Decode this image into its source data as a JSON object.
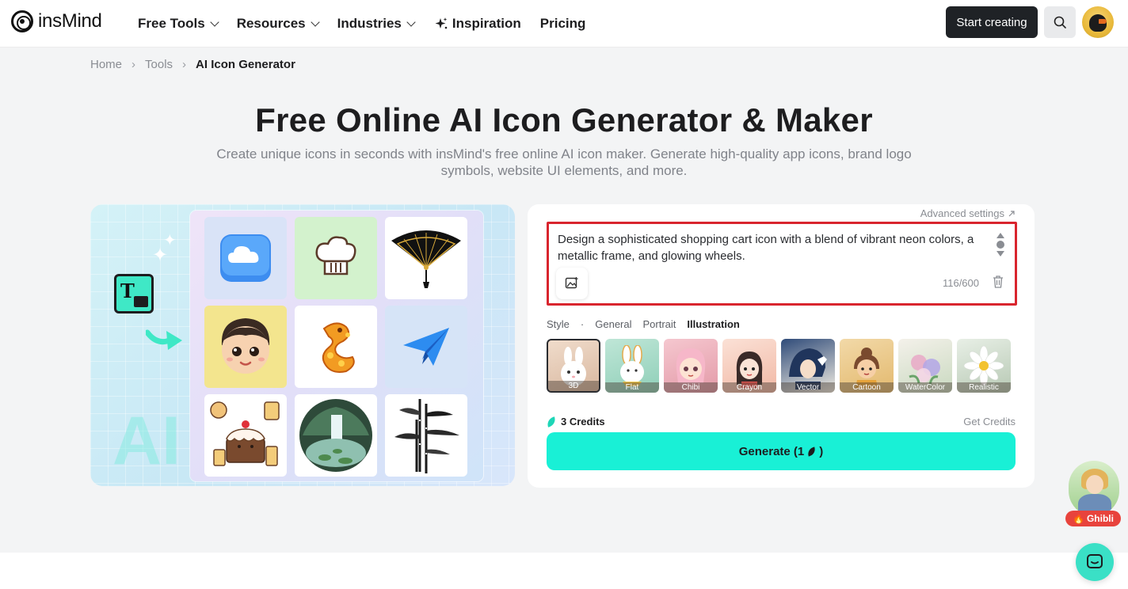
{
  "header": {
    "logo_text": "insMind",
    "nav": [
      {
        "label": "Free Tools",
        "dropdown": true
      },
      {
        "label": "Resources",
        "dropdown": true
      },
      {
        "label": "Industries",
        "dropdown": true
      },
      {
        "label": "Inspiration",
        "icon": "sparkle-icon"
      },
      {
        "label": "Pricing"
      }
    ],
    "start_label": "Start creating"
  },
  "breadcrumb": {
    "home": "Home",
    "tools": "Tools",
    "current": "AI Icon Generator"
  },
  "hero": {
    "title": "Free Online AI Icon Generator & Maker",
    "subtitle": "Create unique icons in seconds with insMind's free online AI icon maker. Generate high-quality app icons, brand logo symbols, website UI elements, and more."
  },
  "showcase": {
    "watermark": "AI",
    "tiles": [
      "cloud-icon",
      "chef-hat-icon",
      "folding-fan-icon",
      "cartoon-boy-icon",
      "golden-dragon-icon",
      "paper-plane-icon",
      "cake-icon",
      "waterfall-icon",
      "bamboo-icon"
    ]
  },
  "generator": {
    "advanced_label": "Advanced settings",
    "prompt": "Design a sophisticated shopping cart icon with a blend of vibrant neon colors, a metallic frame, and glowing wheels.",
    "counter": "116/600",
    "style_label": "Style",
    "style_tabs": [
      "General",
      "Portrait",
      "Illustration"
    ],
    "style_tabs_active": "Illustration",
    "styles": [
      {
        "label": "3D",
        "color_a": "#f0dccb",
        "color_b": "#d9b8a0",
        "active": true
      },
      {
        "label": "Flat",
        "color_a": "#bfe6d7",
        "color_b": "#8fcfb8",
        "active": false
      },
      {
        "label": "Chibi",
        "color_a": "#f5c7cf",
        "color_b": "#e39aa8",
        "active": false
      },
      {
        "label": "Crayon",
        "color_a": "#fbe1d6",
        "color_b": "#f1b8a5",
        "active": false
      },
      {
        "label": "Vector",
        "color_a": "#2f4b79",
        "color_b": "#f2ede2",
        "active": false
      },
      {
        "label": "Cartoon",
        "color_a": "#f2d9a8",
        "color_b": "#e3b96e",
        "active": false
      },
      {
        "label": "WaterColor",
        "color_a": "#f4f1ea",
        "color_b": "#c9d9c0",
        "active": false
      },
      {
        "label": "Realistic",
        "color_a": "#e8efe6",
        "color_b": "#b7c9b4",
        "active": false
      }
    ],
    "credits_label": "3 Credits",
    "get_credits_label": "Get Credits",
    "generate_label_pre": "Generate (1",
    "generate_label_post": ")"
  },
  "floating": {
    "ghibli_label": "Ghibli"
  },
  "colors": {
    "accent": "#19f0d6",
    "highlight_border": "#d9252e",
    "dark_button": "#1f2226"
  }
}
